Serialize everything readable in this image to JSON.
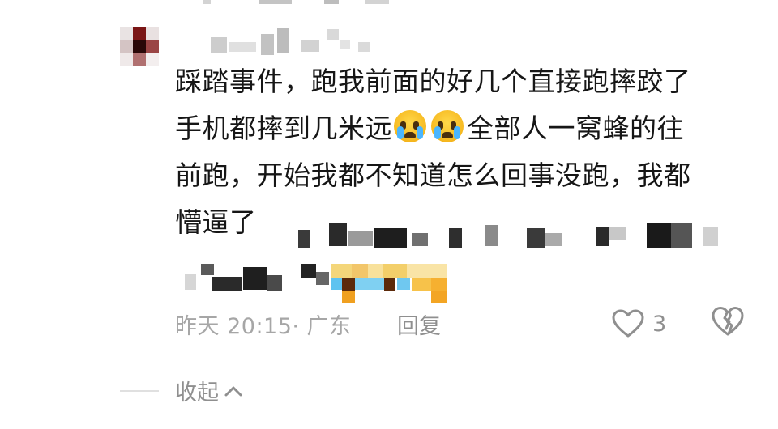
{
  "comment": {
    "line1": "踩踏事件，跑我前面的好几个直接跑摔跤了",
    "line2a": "手机都摔到几米远",
    "line2b": "全部人一窝蜂的往",
    "line3": "前跑，开始我都不知道怎么回事没跑，我都",
    "line4": "懵逼了",
    "emoji_icon": "crying-face"
  },
  "meta": {
    "time_location": "昨天 20:15· 广东",
    "reply_label": "回复",
    "like_count": "3"
  },
  "collapse": {
    "label": "收起"
  },
  "colors": {
    "text": "#161616",
    "meta": "#a6a6a6",
    "action": "#8f8f8f",
    "emoji": "#f6b81f"
  }
}
